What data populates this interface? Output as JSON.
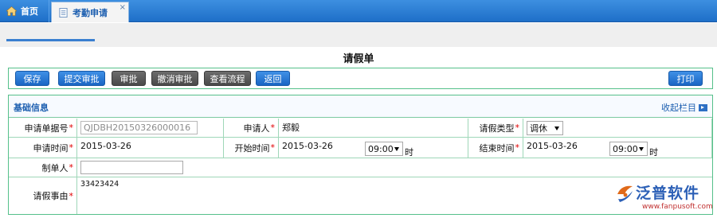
{
  "tabs": [
    {
      "label": "首页"
    },
    {
      "label": "考勤申请",
      "close": "×"
    }
  ],
  "form_title": "请假单",
  "toolbar": {
    "save": "保存",
    "submit": "提交审批",
    "approve": "审批",
    "cancel_approve": "撤消审批",
    "view_flow": "查看流程",
    "back": "返回",
    "print": "打印"
  },
  "panel": {
    "title": "基础信息",
    "collapse": "收起栏目"
  },
  "fields": {
    "application_no": {
      "label": "申请单据号",
      "value": "QJDBH20150326000016"
    },
    "applicant": {
      "label": "申请人",
      "value": "郑毅"
    },
    "leave_type": {
      "label": "请假类型",
      "value": "调休"
    },
    "apply_time": {
      "label": "申请时间",
      "value": "2015-03-26"
    },
    "start_time": {
      "label": "开始时间",
      "date": "2015-03-26",
      "time": "09:00",
      "unit": "时"
    },
    "end_time": {
      "label": "结束时间",
      "date": "2015-03-26",
      "time": "09:00",
      "unit": "时"
    },
    "creator": {
      "label": "制单人",
      "value": ""
    },
    "reason": {
      "label": "请假事由",
      "value": "33423424"
    }
  },
  "required_mark": "*",
  "watermark": {
    "name": "泛普软件",
    "url": "www.fanpusoft.com"
  },
  "colors": {
    "accent": "#1d5fb0",
    "border": "#55c08a",
    "required": "#e00000"
  }
}
